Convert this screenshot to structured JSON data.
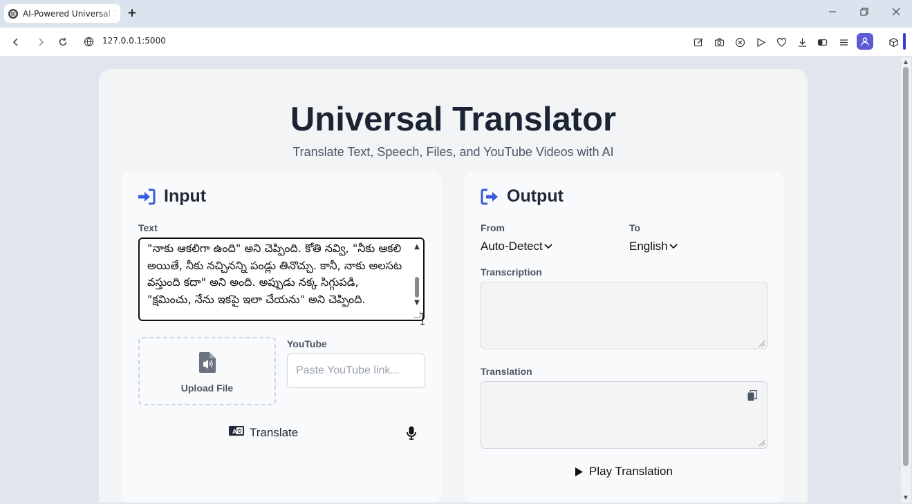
{
  "browser": {
    "tab_title": "AI-Powered Universal Translator",
    "url": "127.0.0.1:5000"
  },
  "app": {
    "title": "Universal Translator",
    "subtitle": "Translate Text, Speech, Files, and YouTube Videos with AI"
  },
  "input_panel": {
    "heading": "Input",
    "text_label": "Text",
    "text_value": "\"నాకు ఆకలిగా ఉంది\" అని చెప్పింది. కోతి నవ్వి, \"నీకు ఆకలి అయితే, నీకు నచ్చినన్ని పండ్లు తినొచ్చు. కానీ, నాకు అలసట వస్తుంది కదా\" అని అంది. అప్పుడు నక్క సిగ్గుపడి, \"క్షమించు, నేను ఇకపై ఇలా చేయను\" అని చెప్పింది.",
    "upload_label": "Upload File",
    "youtube_label": "YouTube",
    "youtube_placeholder": "Paste YouTube link...",
    "translate_label": "Translate"
  },
  "output_panel": {
    "heading": "Output",
    "from_label": "From",
    "from_value": "Auto-Detect",
    "to_label": "To",
    "to_value": "English",
    "transcription_label": "Transcription",
    "transcription_value": "",
    "translation_label": "Translation",
    "translation_value": "",
    "play_label": "Play Translation"
  },
  "colors": {
    "accent": "#3b5bdb",
    "heading": "#1b2434",
    "profile": "#5b5bd6"
  }
}
